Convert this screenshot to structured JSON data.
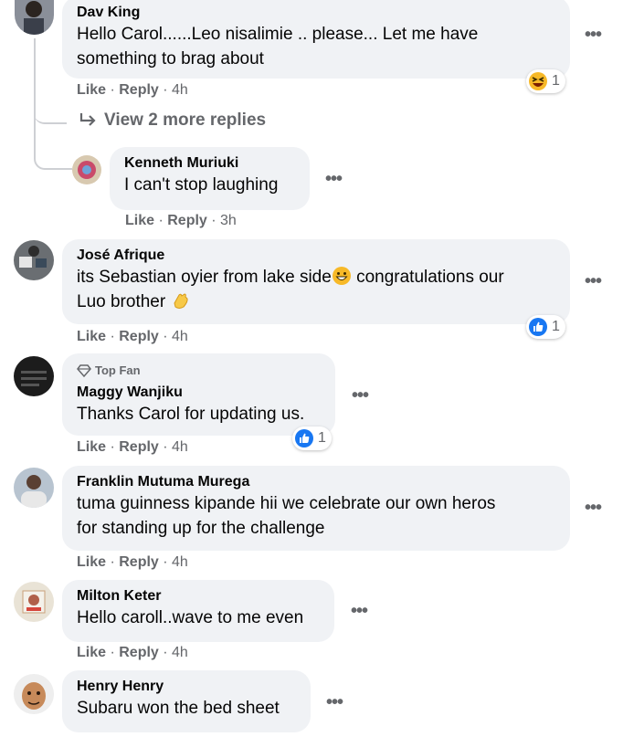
{
  "actions": {
    "like": "Like",
    "reply": "Reply",
    "sep": " · "
  },
  "more_icon": "•••",
  "view_more": {
    "label": "View 2 more replies",
    "icon": "reply-arrow-icon"
  },
  "comments": [
    {
      "name": "Dav King",
      "text_line1": "Hello Carol......Leo nisalimie .. please... Let me have",
      "text_line2": "something to brag about",
      "time": "4h",
      "reaction": {
        "icon": "haha-icon",
        "count": "1"
      }
    },
    {
      "name": "Kenneth Muriuki",
      "text_line1": "I can't stop laughing",
      "time": "3h"
    },
    {
      "name": "José Afrique",
      "text_line1": "its Sebastian oyier from lake side",
      "text_line1b": " congratulations our",
      "text_line2": "Luo brother ",
      "time": "4h",
      "reaction": {
        "icon": "like-icon",
        "count": "1"
      }
    },
    {
      "badge": "Top Fan",
      "name": "Maggy Wanjiku",
      "text_line1": "Thanks Carol for updating us.",
      "time": "4h",
      "reaction": {
        "icon": "like-icon",
        "count": "1"
      }
    },
    {
      "name": "Franklin Mutuma Murega",
      "text_line1": "tuma guinness kipande hii we celebrate our own heros",
      "text_line2": "for standing up for the challenge",
      "time": "4h"
    },
    {
      "name": "Milton Keter",
      "text_line1": "Hello caroll..wave to me even",
      "time": "4h"
    },
    {
      "name": "Henry Henry",
      "text_line1": "Subaru won the bed sheet"
    }
  ],
  "colors": {
    "bubble": "#f0f2f5",
    "meta": "#65676b",
    "like_blue": "#1877f2",
    "haha_yellow": "#f7b928"
  }
}
